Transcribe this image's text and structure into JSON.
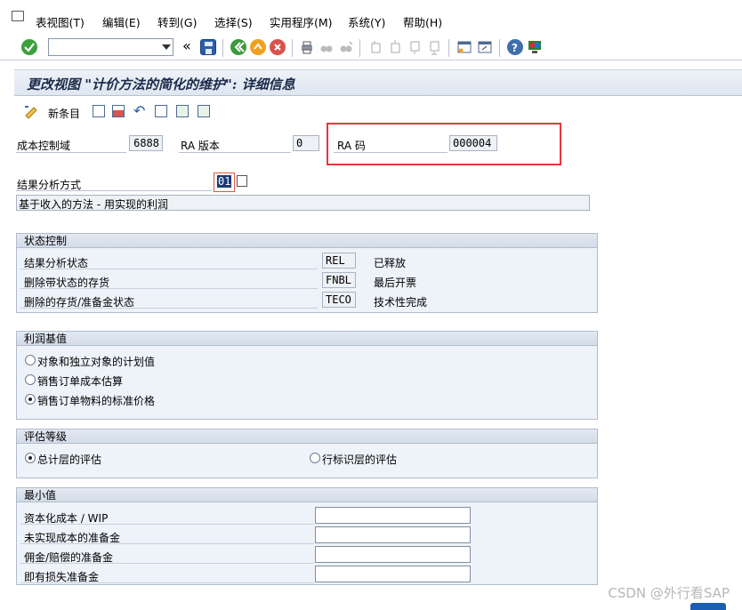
{
  "menu": {
    "items": [
      "表视图(T)",
      "编辑(E)",
      "转到(G)",
      "选择(S)",
      "实用程序(M)",
      "系统(Y)",
      "帮助(H)"
    ]
  },
  "toolbar": {
    "command_value": "",
    "back_glyph": "«",
    "icons": [
      "enter-icon",
      "save-icon",
      "back-icon",
      "exit-icon",
      "cancel-icon",
      "print-icon",
      "find-icon",
      "find-next-icon",
      "first-page-icon",
      "prev-page-icon",
      "next-page-icon",
      "last-page-icon",
      "new-session-icon",
      "shortcut-icon",
      "help-icon",
      "layout-icon"
    ]
  },
  "title": "更改视图 \"计价方法的简化的维护\": 详细信息",
  "app_toolbar": {
    "new_entries": "新条目"
  },
  "header": {
    "controlling_area_label": "成本控制域",
    "controlling_area_value": "6888",
    "ra_version_label": "RA 版本",
    "ra_version_value": "0",
    "ra_key_label": "RA 码",
    "ra_key_value": "000004",
    "method_label": "结果分析方式",
    "method_value": "01",
    "method_desc": "基于收入的方法 - 用实现的利润"
  },
  "status_control": {
    "title": "状态控制",
    "rows": [
      {
        "label": "结果分析状态",
        "code": "REL",
        "text": "已释放"
      },
      {
        "label": "删除带状态的存货",
        "code": "FNBL",
        "text": "最后开票"
      },
      {
        "label": "删除的存货/准备金状态",
        "code": "TECO",
        "text": "技术性完成"
      }
    ]
  },
  "profit_basis": {
    "title": "利润基值",
    "options": [
      {
        "label": "对象和独立对象的计划值",
        "selected": false
      },
      {
        "label": "销售订单成本估算",
        "selected": false
      },
      {
        "label": "销售订单物料的标准价格",
        "selected": true
      }
    ]
  },
  "valuation_level": {
    "title": "评估等级",
    "options": [
      {
        "label": "总计层的评估",
        "selected": true
      },
      {
        "label": "行标识层的评估",
        "selected": false
      }
    ]
  },
  "minimum_values": {
    "title": "最小值",
    "rows": [
      {
        "label": "资本化成本 / WIP",
        "value": ""
      },
      {
        "label": "未实现成本的准备金",
        "value": ""
      },
      {
        "label": "佣金/赔偿的准备金",
        "value": ""
      },
      {
        "label": "即有损失准备金",
        "value": ""
      }
    ]
  },
  "watermark": "CSDN @外行看SAP"
}
